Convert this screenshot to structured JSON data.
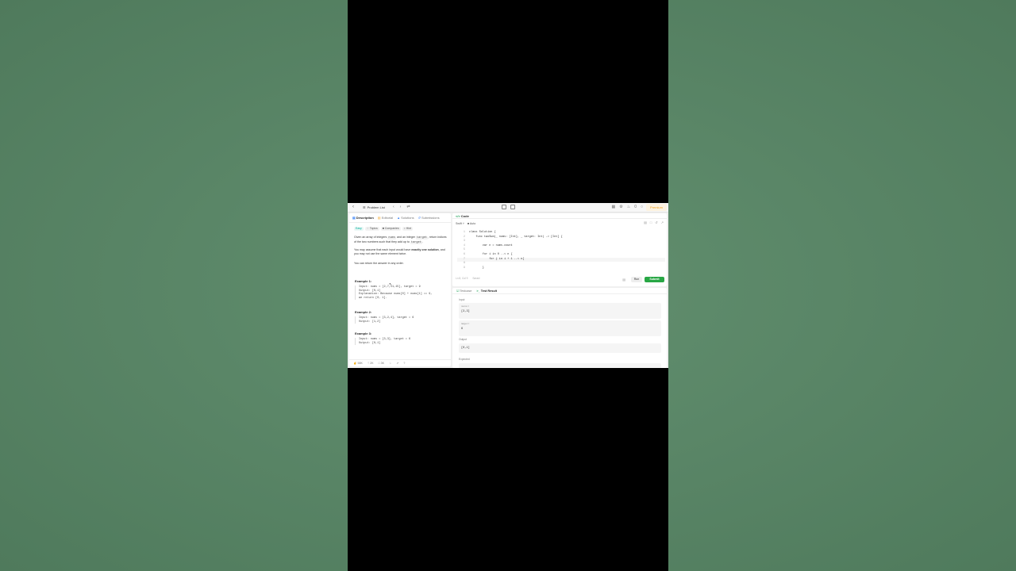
{
  "topnav": {
    "problem_list": "Problem List",
    "premium": "Premium",
    "counter": "0"
  },
  "left": {
    "tabs": [
      "Description",
      "Editorial",
      "Solutions",
      "Submissions"
    ],
    "tags": [
      "Easy",
      "Topics",
      "Companies",
      "Hint"
    ],
    "desc1_a": "Given an array of integers ",
    "desc1_code1": "nums",
    "desc1_b": " and an integer ",
    "desc1_code2": "target",
    "desc1_c": ", return indices of the two numbers such that they add up to ",
    "desc1_code3": "target",
    "desc1_d": ".",
    "desc2_a": "You may assume that each input would have ",
    "desc2_bold": "exactly one solution",
    "desc2_b": ", and you may not use the same element twice.",
    "desc3": "You can return the answer in any order.",
    "examples": [
      {
        "title": "Example 1:",
        "body": "Input: nums = [2,7,11,15], target = 9\nOutput: [0,1]\nExplanation: Because nums[0] + nums[1] == 9,\nwe return [0, 1]."
      },
      {
        "title": "Example 2:",
        "body": "Input: nums = [3,2,4], target = 6\nOutput: [1,2]"
      },
      {
        "title": "Example 3:",
        "body": "Input: nums = [3,3], target = 6\nOutput: [0,1]"
      }
    ],
    "footer": {
      "likes": "58K",
      "comments": "2K",
      "views": "3K"
    }
  },
  "code": {
    "title": "Code",
    "lang": "Swift",
    "mode": "Auto",
    "lines": [
      "class Solution {",
      "    func twoSum(_ nums: [Int], _ target: Int) -> [Int] {",
      "",
      "        var n = nums.count",
      "",
      "        for i in 0 ..< n {",
      "            for j in i + 1 ..< n{",
      "",
      "        }"
    ],
    "status_pos": "Ln 8, Col 9",
    "status_saved": "Saved",
    "run": "Run",
    "submit": "Submit"
  },
  "test": {
    "tabs": [
      "Testcase",
      "Test Result"
    ],
    "input_label": "Input",
    "nums_label": "nums =",
    "nums_value": "[3,3]",
    "target_label": "target =",
    "target_value": "6",
    "output_label": "Output",
    "output_value": "[0,1]",
    "expected_label": "Expected"
  }
}
